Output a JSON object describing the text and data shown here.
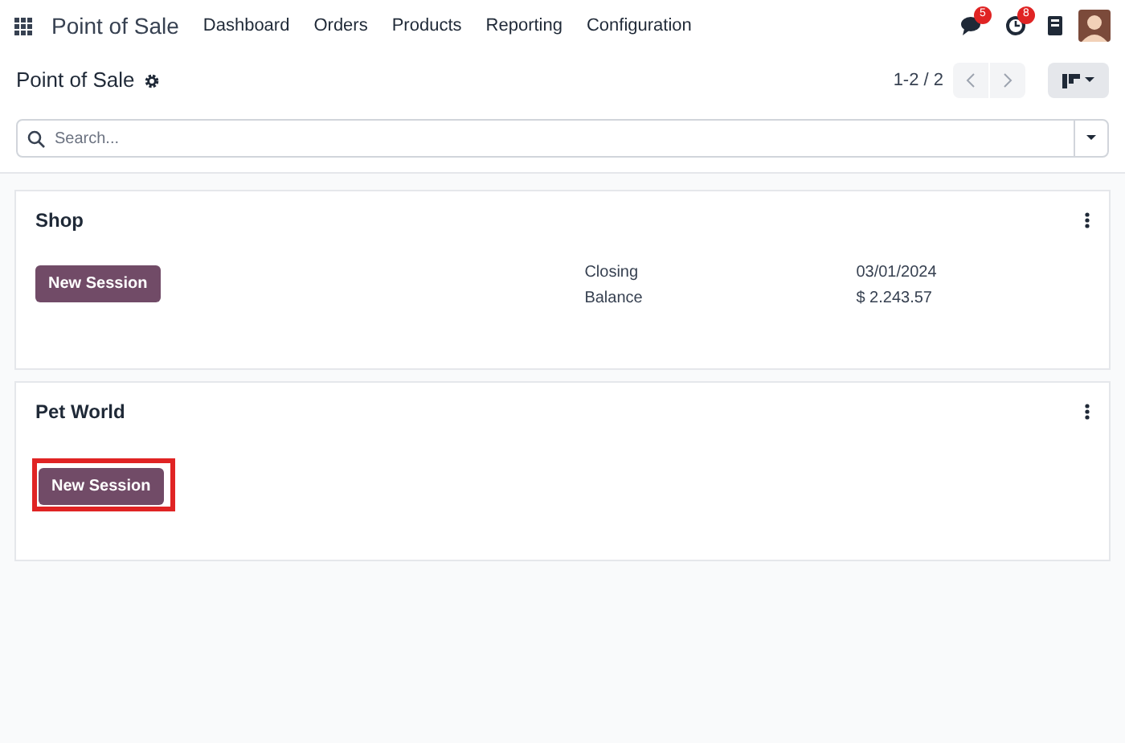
{
  "navbar": {
    "app_name": "Point of Sale",
    "menu": [
      "Dashboard",
      "Orders",
      "Products",
      "Reporting",
      "Configuration"
    ],
    "messages_badge": "5",
    "activities_badge": "8"
  },
  "control_panel": {
    "title": "Point of Sale",
    "pager": "1-2 / 2",
    "search": {
      "placeholder": "Search..."
    }
  },
  "cards": [
    {
      "title": "Shop",
      "button": "New Session",
      "highlighted": false,
      "details": [
        {
          "label": "Closing",
          "value": "03/01/2024"
        },
        {
          "label": "Balance",
          "value": "$ 2.243.57"
        }
      ]
    },
    {
      "title": "Pet World",
      "button": "New Session",
      "highlighted": true
    }
  ]
}
